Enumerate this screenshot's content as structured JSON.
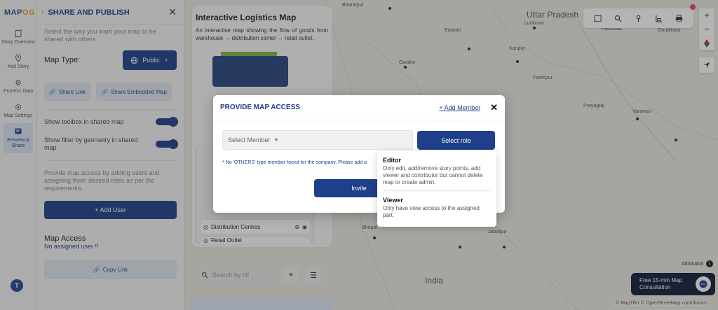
{
  "app": {
    "logo_main": "MAP",
    "logo_accent": "OG"
  },
  "rail": {
    "items": [
      {
        "label": "Story Overview",
        "icon": "story-icon"
      },
      {
        "label": "Add Story",
        "icon": "pin-icon"
      },
      {
        "label": "Process Data",
        "icon": "gear-icon"
      },
      {
        "label": "Map Settings",
        "icon": "settings-icon"
      },
      {
        "label": "Preview & Share",
        "icon": "preview-icon",
        "active": true
      }
    ],
    "avatar": "T"
  },
  "panel": {
    "title": "SHARE AND PUBLISH",
    "subtitle": "Select the way you want your map to be shared with others",
    "map_type_label": "Map Type:",
    "map_type_value": "Public",
    "share_link": "Share Link",
    "share_embedded": "Share Embedded Map",
    "toggle_toolbox": "Show toolbox in shared map",
    "toggle_filter": "Show filter by geometry in shared map",
    "access_desc": "Provide map access by adding users and assigning them desired roles as per the requirements.",
    "add_user": "+ Add User",
    "map_access_title": "Map Access",
    "no_assigned": "No assigned user !!",
    "copy_link": "Copy Link"
  },
  "story": {
    "title": "Interactive Logistics Map",
    "description": "An interactive map showing the flow of goods from warehouse → distribution center → retail outlet.",
    "legend_items": [
      "Distribution Centres",
      "Retail Outlet"
    ],
    "search_placeholder": "Search by titl"
  },
  "map": {
    "cities": [
      "Bharatpur",
      "Uttar Pradesh",
      "Lucknow",
      "Faizabad",
      "Gorakhpur",
      "Etawah",
      "Gwalior",
      "Kanpur",
      "Fatehpur",
      "Prayagraj",
      "Varanasi",
      "Jabalpur",
      "Bhopal"
    ],
    "country": "India",
    "attribution": "Attribution",
    "copyright": "© MapTiler © OpenStreetMap contributors",
    "consult_line1": "Free 15-min Map",
    "consult_line2": "Consultation"
  },
  "modal": {
    "title": "PROVIDE MAP ACCESS",
    "add_member": "+ Add Member",
    "close": "✕",
    "select_member_placeholder": "Select Member",
    "select_role": "Select role",
    "note": "* No 'OTHERS' type member found for the company. Please add a",
    "invite": "Invite",
    "roles": [
      {
        "name": "Editor",
        "desc": "Only edit, add/remove story points, add viewer and contributor but cannot delete map or create admin."
      },
      {
        "name": "Viewer",
        "desc": "Only have view access to the assigned part."
      }
    ]
  },
  "colors": {
    "brand": "#1e3f8a",
    "accent": "#e9a321",
    "overlay": "rgba(40,40,40,0.35)"
  }
}
